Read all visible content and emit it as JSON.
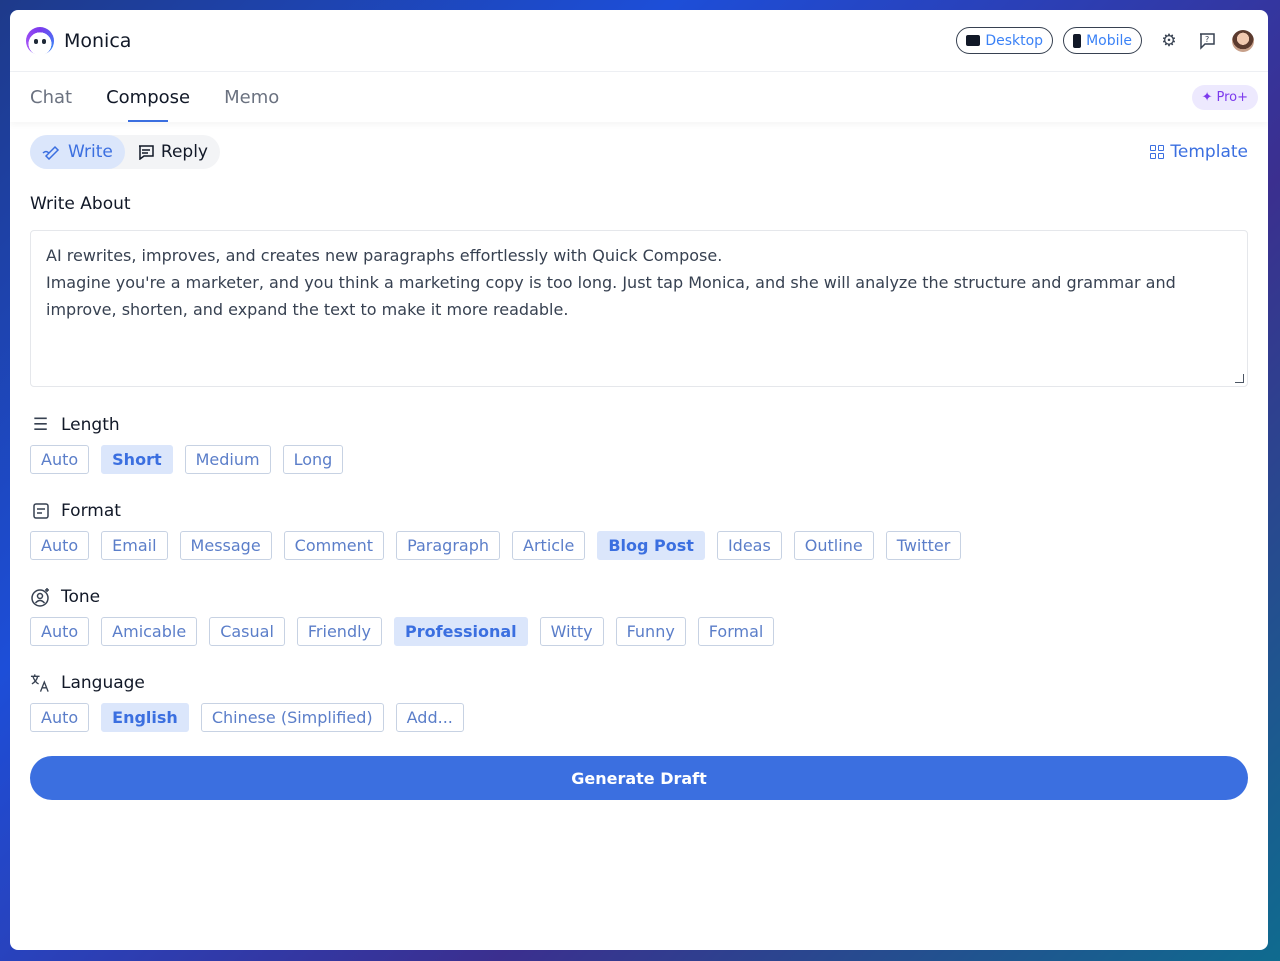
{
  "app": {
    "name": "Monica"
  },
  "header": {
    "desktop_label": "Desktop",
    "mobile_label": "Mobile"
  },
  "nav": {
    "tabs": [
      {
        "label": "Chat"
      },
      {
        "label": "Compose"
      },
      {
        "label": "Memo"
      }
    ],
    "active_tab": "Compose",
    "pro_label": "Pro+"
  },
  "mode": {
    "write_label": "Write",
    "reply_label": "Reply",
    "active": "Write",
    "template_label": "Template"
  },
  "write_about": {
    "title": "Write About",
    "line1": "AI rewrites, improves, and creates new paragraphs effortlessly with Quick Compose.",
    "line2": "Imagine you're a marketer, and you think a marketing copy is too long. Just tap Monica, and she will analyze the structure and grammar and improve, shorten, and expand the text to make it more readable."
  },
  "length": {
    "title": "Length",
    "options": [
      "Auto",
      "Short",
      "Medium",
      "Long"
    ],
    "selected": "Short"
  },
  "format": {
    "title": "Format",
    "options": [
      "Auto",
      "Email",
      "Message",
      "Comment",
      "Paragraph",
      "Article",
      "Blog Post",
      "Ideas",
      "Outline",
      "Twitter"
    ],
    "selected": "Blog Post"
  },
  "tone": {
    "title": "Tone",
    "options": [
      "Auto",
      "Amicable",
      "Casual",
      "Friendly",
      "Professional",
      "Witty",
      "Funny",
      "Formal"
    ],
    "selected": "Professional"
  },
  "language": {
    "title": "Language",
    "options": [
      "Auto",
      "English",
      "Chinese (Simplified)",
      "Add..."
    ],
    "selected": "English"
  },
  "generate_label": "Generate Draft",
  "colors": {
    "accent": "#3b6fe0",
    "selected_bg": "#dbe6fb",
    "pro": "#7c3aed"
  },
  "icons": [
    "monica-logo-icon",
    "laptop-icon",
    "phone-icon",
    "gear-icon",
    "feedback-icon",
    "sparkle-icon",
    "pen-icon",
    "reply-icon",
    "grid-icon",
    "lines-icon",
    "format-icon",
    "tone-icon",
    "translate-icon"
  ]
}
